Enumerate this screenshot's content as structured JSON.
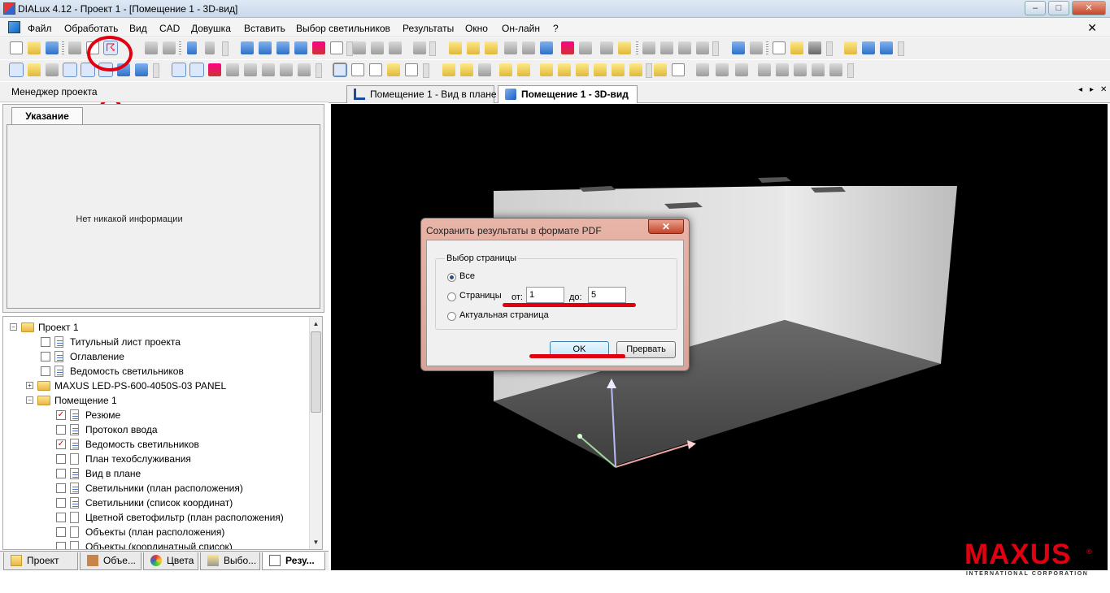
{
  "window": {
    "title": "DIALux 4.12 - Проект 1 - [Помещение 1 - 3D-вид]",
    "min": "–",
    "max": "□",
    "close": "✕"
  },
  "menu": [
    "Файл",
    "Обработать",
    "Вид",
    "CAD",
    "Довушка",
    "Вставить",
    "Выбор светильников",
    "Результаты",
    "Окно",
    "Он-лайн",
    "?"
  ],
  "menu_close": "✕",
  "left_panel": {
    "title": "Менеджер проекта",
    "hint_tab": "Указание",
    "no_info": "Нет никакой информации"
  },
  "tree": [
    {
      "label": "Проект 1",
      "level": 0,
      "kind": "folder",
      "expander": "−"
    },
    {
      "label": "Титульный лист проекта",
      "level": 1,
      "kind": "page",
      "checked": false
    },
    {
      "label": "Оглавление",
      "level": 1,
      "kind": "page",
      "checked": false
    },
    {
      "label": "Ведомость светильников",
      "level": 1,
      "kind": "page",
      "checked": false
    },
    {
      "label": "MAXUS LED-PS-600-4050S-03 PANEL",
      "level": 1,
      "kind": "folder",
      "expander": "+"
    },
    {
      "label": "Помещение 1",
      "level": 1,
      "kind": "folder",
      "expander": "−"
    },
    {
      "label": "Резюме",
      "level": 2,
      "kind": "page",
      "checked": true
    },
    {
      "label": "Протокол ввода",
      "level": 2,
      "kind": "page",
      "checked": false
    },
    {
      "label": "Ведомость светильников",
      "level": 2,
      "kind": "page",
      "checked": true
    },
    {
      "label": "План техобслуживания",
      "level": 2,
      "kind": "blank",
      "checked": false
    },
    {
      "label": "Вид в плане",
      "level": 2,
      "kind": "page",
      "checked": false
    },
    {
      "label": "Светильники (план расположения)",
      "level": 2,
      "kind": "page",
      "checked": false
    },
    {
      "label": "Светильники (список координат)",
      "level": 2,
      "kind": "page",
      "checked": false
    },
    {
      "label": "Цветной светофильтр (план расположения)",
      "level": 2,
      "kind": "blank",
      "checked": false
    },
    {
      "label": "Объекты (план расположения)",
      "level": 2,
      "kind": "blank",
      "checked": false
    },
    {
      "label": "Объекты (координатный список)",
      "level": 2,
      "kind": "blank",
      "checked": false
    }
  ],
  "bottom_tabs": [
    "Проект",
    "Объе...",
    "Цвета",
    "Выбо...",
    "Резу..."
  ],
  "view_tabs": [
    "Помещение 1 - Вид в плане",
    "Помещение 1 - 3D-вид"
  ],
  "view_nav": {
    "left": "◂",
    "right": "▸",
    "close": "✕"
  },
  "dialog": {
    "title": "Сохранить результаты в формате PDF",
    "close": "✕",
    "group_title": "Выбор страницы",
    "options": [
      "Все",
      "Страницы",
      "Актуальная страница"
    ],
    "selected": "Все",
    "from_label": "от:",
    "from_value": "1",
    "to_label": "до:",
    "to_value": "5",
    "ok": "OK",
    "cancel": "Прервать"
  },
  "annotation": {
    "step": "1",
    "color": "#e00010"
  },
  "logo": {
    "name": "MAXUS",
    "reg": "®",
    "sub": "INTERNATIONAL CORPORATION"
  },
  "colors": {
    "accent": "#e00010",
    "viewport": "#000000",
    "folder": "#e8b64a"
  }
}
